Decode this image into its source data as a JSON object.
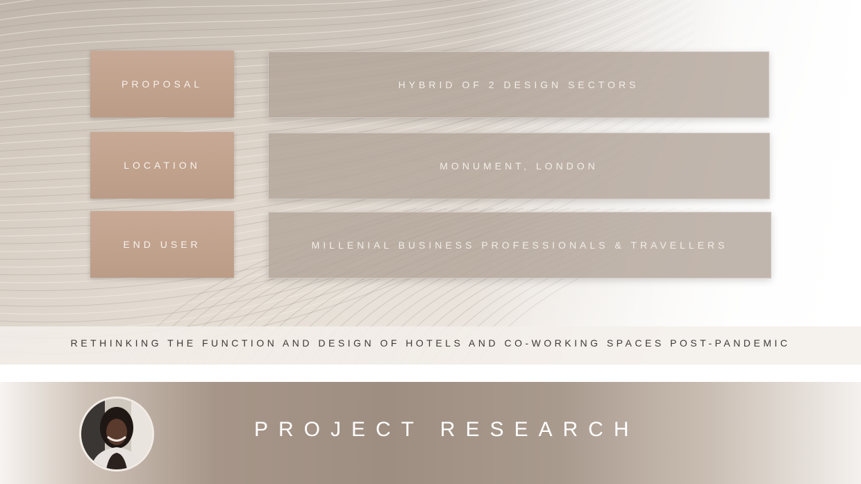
{
  "rows": [
    {
      "label": "PROPOSAL",
      "value": "HYBRID OF 2 DESIGN SECTORS"
    },
    {
      "label": "LOCATION",
      "value": "MONUMENT, LONDON"
    },
    {
      "label": "END USER",
      "value": "MILLENIAL BUSINESS PROFESSIONALS & TRAVELLERS"
    }
  ],
  "tagline": "RETHINKING THE FUNCTION AND DESIGN OF HOTELS AND CO-WORKING SPACES POST-PANDEMIC",
  "footer": {
    "title": "PROJECT RESEARCH"
  }
}
